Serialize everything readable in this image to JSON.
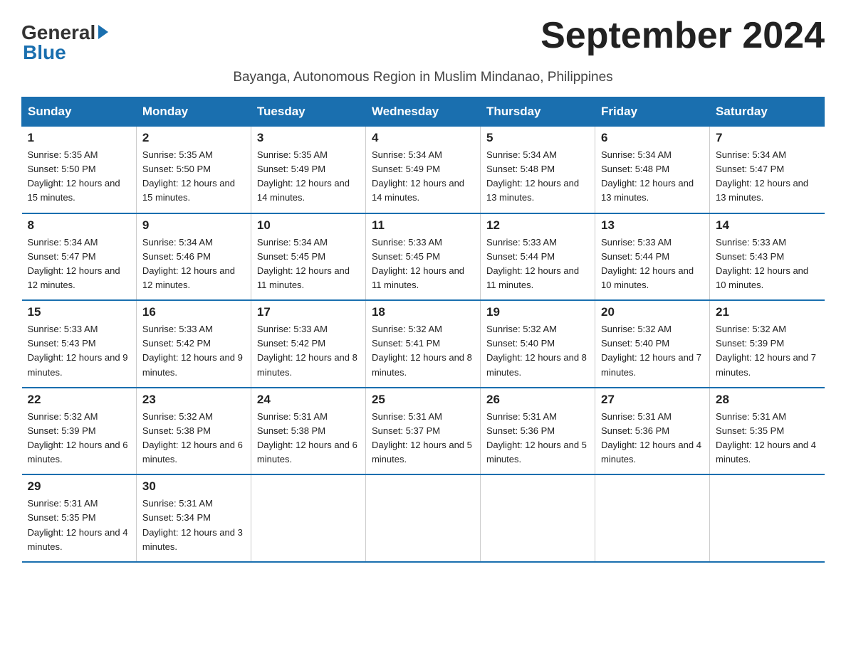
{
  "header": {
    "logo_general": "General",
    "logo_blue": "Blue",
    "title": "September 2024",
    "subtitle": "Bayanga, Autonomous Region in Muslim Mindanao, Philippines"
  },
  "days_of_week": [
    "Sunday",
    "Monday",
    "Tuesday",
    "Wednesday",
    "Thursday",
    "Friday",
    "Saturday"
  ],
  "weeks": [
    [
      {
        "day": "1",
        "sunrise": "Sunrise: 5:35 AM",
        "sunset": "Sunset: 5:50 PM",
        "daylight": "Daylight: 12 hours and 15 minutes."
      },
      {
        "day": "2",
        "sunrise": "Sunrise: 5:35 AM",
        "sunset": "Sunset: 5:50 PM",
        "daylight": "Daylight: 12 hours and 15 minutes."
      },
      {
        "day": "3",
        "sunrise": "Sunrise: 5:35 AM",
        "sunset": "Sunset: 5:49 PM",
        "daylight": "Daylight: 12 hours and 14 minutes."
      },
      {
        "day": "4",
        "sunrise": "Sunrise: 5:34 AM",
        "sunset": "Sunset: 5:49 PM",
        "daylight": "Daylight: 12 hours and 14 minutes."
      },
      {
        "day": "5",
        "sunrise": "Sunrise: 5:34 AM",
        "sunset": "Sunset: 5:48 PM",
        "daylight": "Daylight: 12 hours and 13 minutes."
      },
      {
        "day": "6",
        "sunrise": "Sunrise: 5:34 AM",
        "sunset": "Sunset: 5:48 PM",
        "daylight": "Daylight: 12 hours and 13 minutes."
      },
      {
        "day": "7",
        "sunrise": "Sunrise: 5:34 AM",
        "sunset": "Sunset: 5:47 PM",
        "daylight": "Daylight: 12 hours and 13 minutes."
      }
    ],
    [
      {
        "day": "8",
        "sunrise": "Sunrise: 5:34 AM",
        "sunset": "Sunset: 5:47 PM",
        "daylight": "Daylight: 12 hours and 12 minutes."
      },
      {
        "day": "9",
        "sunrise": "Sunrise: 5:34 AM",
        "sunset": "Sunset: 5:46 PM",
        "daylight": "Daylight: 12 hours and 12 minutes."
      },
      {
        "day": "10",
        "sunrise": "Sunrise: 5:34 AM",
        "sunset": "Sunset: 5:45 PM",
        "daylight": "Daylight: 12 hours and 11 minutes."
      },
      {
        "day": "11",
        "sunrise": "Sunrise: 5:33 AM",
        "sunset": "Sunset: 5:45 PM",
        "daylight": "Daylight: 12 hours and 11 minutes."
      },
      {
        "day": "12",
        "sunrise": "Sunrise: 5:33 AM",
        "sunset": "Sunset: 5:44 PM",
        "daylight": "Daylight: 12 hours and 11 minutes."
      },
      {
        "day": "13",
        "sunrise": "Sunrise: 5:33 AM",
        "sunset": "Sunset: 5:44 PM",
        "daylight": "Daylight: 12 hours and 10 minutes."
      },
      {
        "day": "14",
        "sunrise": "Sunrise: 5:33 AM",
        "sunset": "Sunset: 5:43 PM",
        "daylight": "Daylight: 12 hours and 10 minutes."
      }
    ],
    [
      {
        "day": "15",
        "sunrise": "Sunrise: 5:33 AM",
        "sunset": "Sunset: 5:43 PM",
        "daylight": "Daylight: 12 hours and 9 minutes."
      },
      {
        "day": "16",
        "sunrise": "Sunrise: 5:33 AM",
        "sunset": "Sunset: 5:42 PM",
        "daylight": "Daylight: 12 hours and 9 minutes."
      },
      {
        "day": "17",
        "sunrise": "Sunrise: 5:33 AM",
        "sunset": "Sunset: 5:42 PM",
        "daylight": "Daylight: 12 hours and 8 minutes."
      },
      {
        "day": "18",
        "sunrise": "Sunrise: 5:32 AM",
        "sunset": "Sunset: 5:41 PM",
        "daylight": "Daylight: 12 hours and 8 minutes."
      },
      {
        "day": "19",
        "sunrise": "Sunrise: 5:32 AM",
        "sunset": "Sunset: 5:40 PM",
        "daylight": "Daylight: 12 hours and 8 minutes."
      },
      {
        "day": "20",
        "sunrise": "Sunrise: 5:32 AM",
        "sunset": "Sunset: 5:40 PM",
        "daylight": "Daylight: 12 hours and 7 minutes."
      },
      {
        "day": "21",
        "sunrise": "Sunrise: 5:32 AM",
        "sunset": "Sunset: 5:39 PM",
        "daylight": "Daylight: 12 hours and 7 minutes."
      }
    ],
    [
      {
        "day": "22",
        "sunrise": "Sunrise: 5:32 AM",
        "sunset": "Sunset: 5:39 PM",
        "daylight": "Daylight: 12 hours and 6 minutes."
      },
      {
        "day": "23",
        "sunrise": "Sunrise: 5:32 AM",
        "sunset": "Sunset: 5:38 PM",
        "daylight": "Daylight: 12 hours and 6 minutes."
      },
      {
        "day": "24",
        "sunrise": "Sunrise: 5:31 AM",
        "sunset": "Sunset: 5:38 PM",
        "daylight": "Daylight: 12 hours and 6 minutes."
      },
      {
        "day": "25",
        "sunrise": "Sunrise: 5:31 AM",
        "sunset": "Sunset: 5:37 PM",
        "daylight": "Daylight: 12 hours and 5 minutes."
      },
      {
        "day": "26",
        "sunrise": "Sunrise: 5:31 AM",
        "sunset": "Sunset: 5:36 PM",
        "daylight": "Daylight: 12 hours and 5 minutes."
      },
      {
        "day": "27",
        "sunrise": "Sunrise: 5:31 AM",
        "sunset": "Sunset: 5:36 PM",
        "daylight": "Daylight: 12 hours and 4 minutes."
      },
      {
        "day": "28",
        "sunrise": "Sunrise: 5:31 AM",
        "sunset": "Sunset: 5:35 PM",
        "daylight": "Daylight: 12 hours and 4 minutes."
      }
    ],
    [
      {
        "day": "29",
        "sunrise": "Sunrise: 5:31 AM",
        "sunset": "Sunset: 5:35 PM",
        "daylight": "Daylight: 12 hours and 4 minutes."
      },
      {
        "day": "30",
        "sunrise": "Sunrise: 5:31 AM",
        "sunset": "Sunset: 5:34 PM",
        "daylight": "Daylight: 12 hours and 3 minutes."
      },
      null,
      null,
      null,
      null,
      null
    ]
  ]
}
